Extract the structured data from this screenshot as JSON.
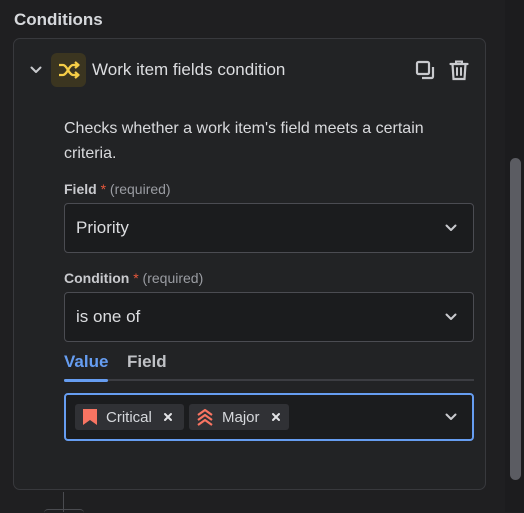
{
  "section": {
    "title": "Conditions"
  },
  "condition": {
    "title": "Work item fields condition",
    "description": "Checks whether a work item's field meets a certain criteria.",
    "icon": "shuffle-icon",
    "accent_color": "#f5cd47"
  },
  "field": {
    "label": "Field",
    "required_mark": "*",
    "required_hint": "(required)",
    "value": "Priority"
  },
  "condition_select": {
    "label": "Condition",
    "required_mark": "*",
    "required_hint": "(required)",
    "value": "is one of"
  },
  "tabs": [
    {
      "label": "Value",
      "active": true
    },
    {
      "label": "Field",
      "active": false
    }
  ],
  "selected_values": [
    {
      "label": "Critical",
      "icon": "priority-critical-icon",
      "color": "#f87462"
    },
    {
      "label": "Major",
      "icon": "priority-major-icon",
      "color": "#f87462"
    }
  ],
  "colors": {
    "background": "#1f1f21",
    "tab_active": "#669df1",
    "required": "#e8583c"
  }
}
